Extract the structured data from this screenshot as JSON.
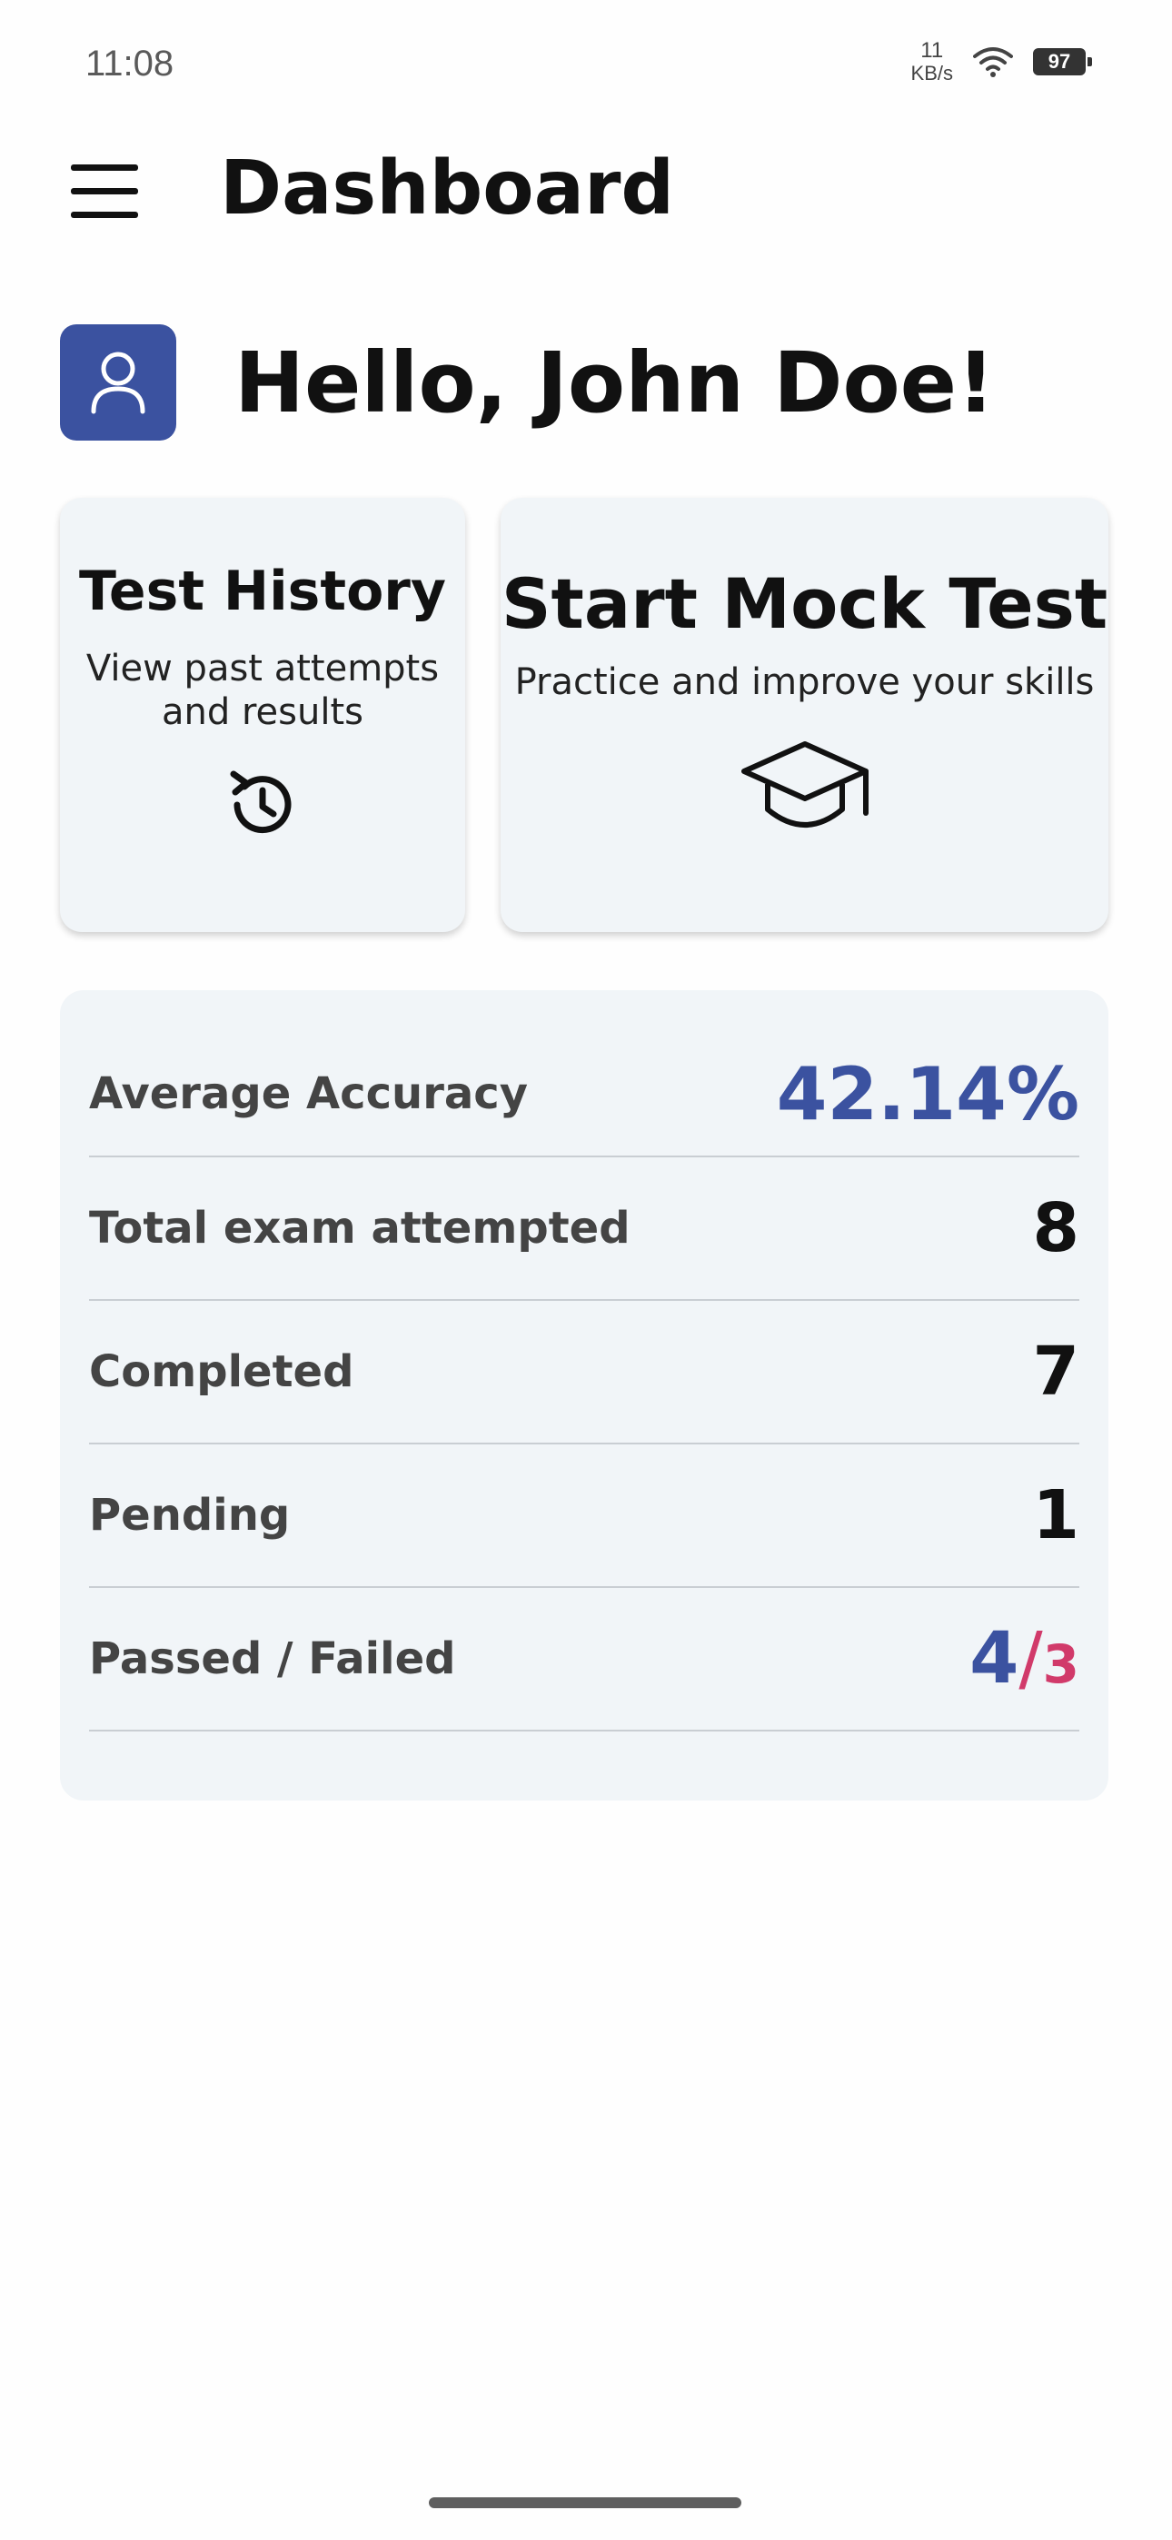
{
  "status_bar": {
    "time": "11:08",
    "net_speed_value": "11",
    "net_speed_unit": "KB/s",
    "battery": "97",
    "icons": [
      "wifi-icon",
      "battery-icon"
    ]
  },
  "app_bar": {
    "title": "Dashboard",
    "menu_icon": "hamburger-menu-icon"
  },
  "greeting": {
    "text": "Hello, John Doe!",
    "avatar_icon": "user-icon",
    "avatar_color": "#3b52a0"
  },
  "cards": {
    "history": {
      "title": "Test History",
      "description": "View past attempts and results",
      "icon": "history-icon"
    },
    "mock_test": {
      "title": "Start Mock Test",
      "description": "Practice and improve your skills",
      "icon": "graduation-cap-icon"
    }
  },
  "stats": {
    "average_accuracy": {
      "label": "Average Accuracy",
      "value": "42.14%"
    },
    "total_attempted": {
      "label": "Total exam attempted",
      "value": "8"
    },
    "completed": {
      "label": "Completed",
      "value": "7"
    },
    "pending": {
      "label": "Pending",
      "value": "1"
    },
    "passed_failed": {
      "label": "Passed / Failed",
      "passed": "4",
      "separator": "/",
      "failed": "3"
    }
  },
  "colors": {
    "accent": "#3b52a0",
    "failed": "#d13a6a",
    "card_background": "#f1f5f8"
  }
}
